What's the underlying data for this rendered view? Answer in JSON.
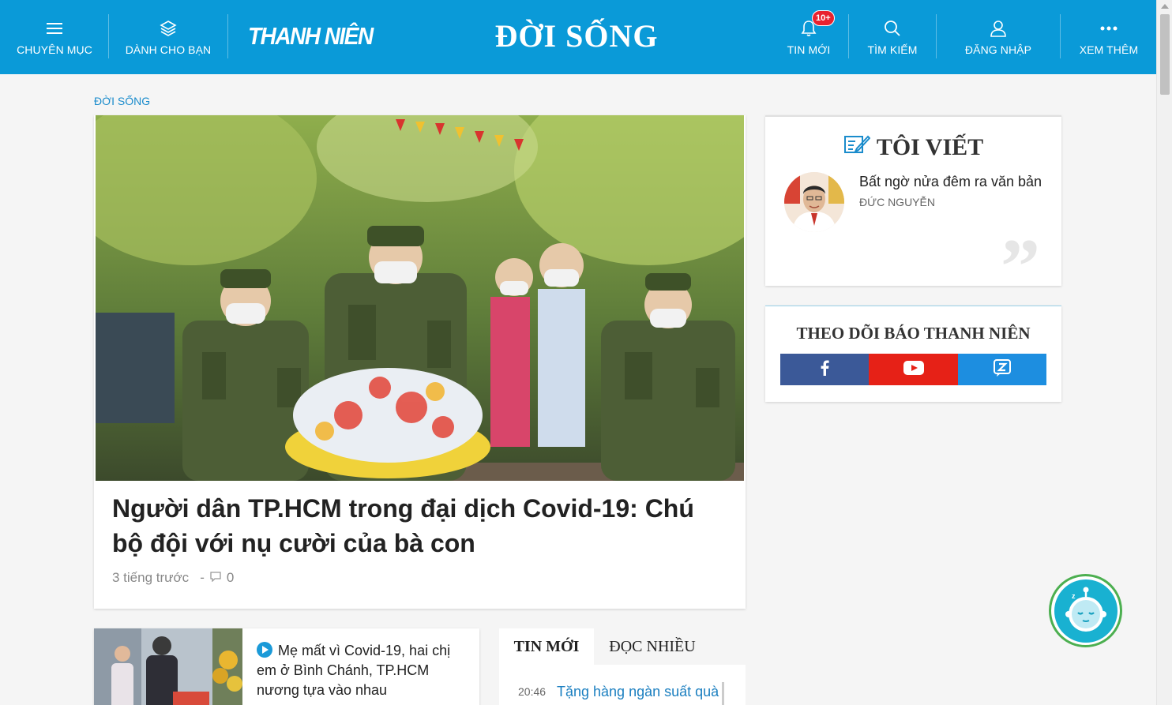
{
  "header": {
    "menu_label": "CHUYÊN MỤC",
    "for_you_label": "DÀNH CHO BẠN",
    "logo_text": "THANH NIÊN",
    "section_title": "ĐỜI SỐNG",
    "news_label": "TIN MỚI",
    "news_badge": "10+",
    "search_label": "TÌM KIẾM",
    "login_label": "ĐĂNG NHẬP",
    "more_label": "XEM THÊM"
  },
  "breadcrumb": "ĐỜI SỐNG",
  "feature": {
    "title": "Người dân TP.HCM trong đại dịch Covid-19: Chú bộ đội với nụ cười của bà con",
    "time": "3 tiếng trước",
    "separator": "-",
    "comments": "0"
  },
  "toi_viet": {
    "title": "TÔI VIẾT",
    "headline": "Bất ngờ nửa đêm ra văn bản",
    "author": "ĐỨC NGUYỄN",
    "quote": "”"
  },
  "follow": {
    "title": "THEO DÕI BÁO THANH NIÊN",
    "facebook_color": "#3b5998",
    "youtube_color": "#e62117",
    "zalo_color": "#1d8ee0"
  },
  "small_article": {
    "title": "Mẹ mất vì Covid-19, hai chị em ở Bình Chánh, TP.HCM nương tựa vào nhau"
  },
  "tabs": {
    "tin_moi": "TIN MỚI",
    "doc_nhieu": "ĐỌC NHIỀU"
  },
  "tin_moi_list": [
    {
      "time": "20:46",
      "title": "Tặng hàng ngàn suất quà"
    }
  ],
  "colors": {
    "header_bg": "#0a9ad8",
    "accent": "#1b8ccc"
  }
}
